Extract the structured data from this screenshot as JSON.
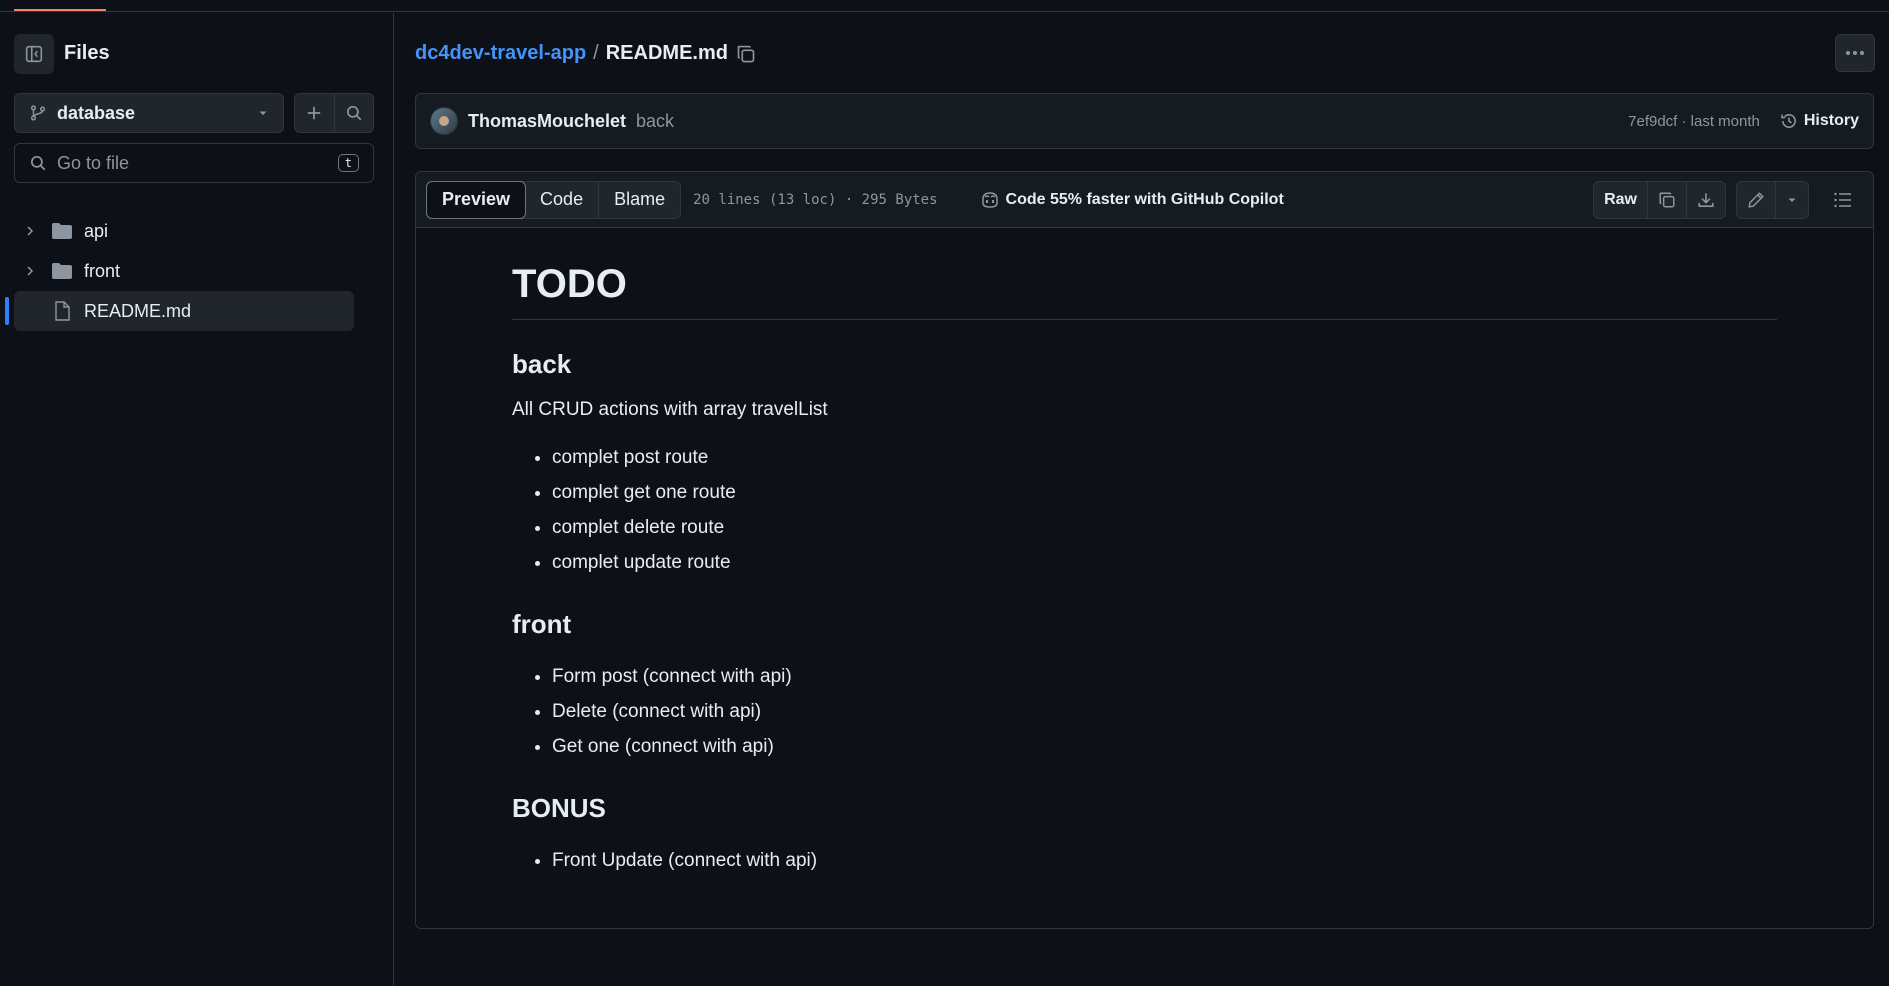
{
  "sidebar": {
    "title": "Files",
    "branch": "database",
    "goto_placeholder": "Go to file",
    "goto_shortcut": "t",
    "tree": [
      {
        "label": "api",
        "type": "folder"
      },
      {
        "label": "front",
        "type": "folder"
      },
      {
        "label": "README.md",
        "type": "file",
        "selected": true
      }
    ]
  },
  "breadcrumb": {
    "repo": "dc4dev-travel-app",
    "separator": "/",
    "file": "README.md"
  },
  "commit": {
    "author": "ThomasMouchelet",
    "message": "back",
    "meta": "7ef9dcf · last month",
    "history_label": "History"
  },
  "file_toolbar": {
    "tabs": [
      "Preview",
      "Code",
      "Blame"
    ],
    "active_tab": "Preview",
    "info": "20 lines (13 loc) · 295 Bytes",
    "copilot": "Code 55% faster with GitHub Copilot",
    "raw_label": "Raw"
  },
  "readme": {
    "title": "TODO",
    "back_heading": "back",
    "back_intro": "All CRUD actions with array travelList",
    "back_items": [
      "complet post route",
      "complet get one route",
      "complet delete route",
      "complet update route"
    ],
    "front_heading": "front",
    "front_items": [
      "Form post (connect with api)",
      "Delete (connect with api)",
      "Get one (connect with api)"
    ],
    "bonus_heading": "BONUS",
    "bonus_items": [
      "Front Update (connect with api)"
    ]
  },
  "colors": {
    "background": "#0d1117",
    "link": "#4493f8",
    "accent": "#f78166",
    "selection": "#2f81f7"
  }
}
